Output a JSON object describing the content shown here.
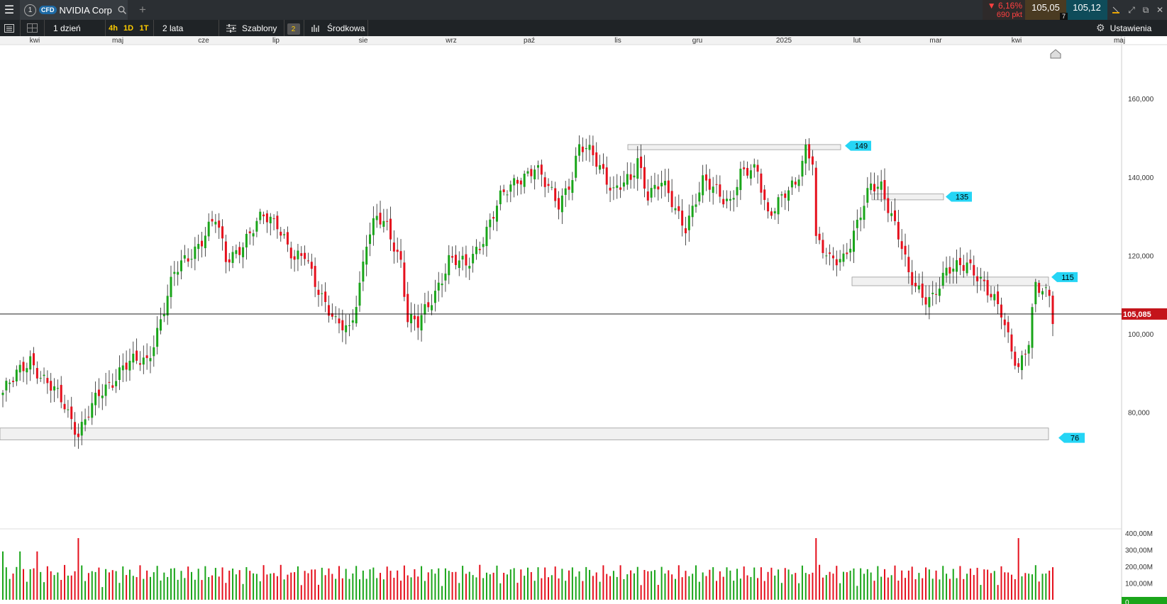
{
  "topbar": {
    "instrument_number": "1",
    "instrument_type": "CFD",
    "instrument_name": "NVIDIA Corp",
    "change_pct": "▼ 6,16%",
    "change_pts": "690 pkt",
    "bid": "105,05",
    "ask": "105,12",
    "spread": "7"
  },
  "toolbar": {
    "interval": "1 dzień",
    "quick_intervals": [
      "4h",
      "1D",
      "1T"
    ],
    "range": "2 lata",
    "templates": "Szablony",
    "templates_count": "2",
    "indicator": "Środkowa",
    "settings": "Ustawienia"
  },
  "colors": {
    "up": "#1aa51a",
    "down": "#e5101d",
    "current_price_bg": "#c4141b",
    "level_bg": "#25d5f5"
  },
  "chart_data": {
    "type": "candlestick",
    "xaxis_months": [
      "kwi",
      "maj",
      "cze",
      "lip",
      "sie",
      "wrz",
      "paź",
      "lis",
      "gru",
      "2025",
      "lut",
      "mar",
      "kwi",
      "maj"
    ],
    "ylim": [
      68000,
      168000
    ],
    "yticks": [
      "160,000",
      "140,000",
      "120,000",
      "100,000",
      "80,000"
    ],
    "current_price": "105,085",
    "current_price_value": 105085,
    "levels": [
      {
        "label": "149",
        "value": 148000,
        "zone": [
          147000,
          148300
        ]
      },
      {
        "label": "135",
        "value": 135000,
        "zone": [
          134200,
          135700
        ]
      },
      {
        "label": "115",
        "value": 114500,
        "zone": [
          112300,
          114500
        ]
      },
      {
        "label": "76",
        "value": 73500,
        "zone": [
          73000,
          76000
        ]
      }
    ],
    "price_anchors": [
      [
        0,
        85000
      ],
      [
        3,
        88000
      ],
      [
        8,
        94000
      ],
      [
        12,
        88000
      ],
      [
        18,
        82000
      ],
      [
        22,
        75000
      ],
      [
        28,
        84000
      ],
      [
        35,
        92000
      ],
      [
        42,
        93000
      ],
      [
        46,
        104000
      ],
      [
        50,
        115000
      ],
      [
        55,
        121000
      ],
      [
        62,
        129000
      ],
      [
        65,
        119000
      ],
      [
        72,
        125000
      ],
      [
        76,
        130000
      ],
      [
        80,
        129000
      ],
      [
        85,
        118000
      ],
      [
        88,
        120000
      ],
      [
        93,
        110000
      ],
      [
        97,
        102000
      ],
      [
        101,
        101000
      ],
      [
        104,
        113000
      ],
      [
        106,
        124000
      ],
      [
        109,
        129000
      ],
      [
        112,
        127000
      ],
      [
        116,
        119000
      ],
      [
        118,
        104000
      ],
      [
        121,
        102000
      ],
      [
        124,
        107000
      ],
      [
        130,
        119000
      ],
      [
        135,
        117000
      ],
      [
        140,
        125000
      ],
      [
        145,
        134000
      ],
      [
        150,
        140000
      ],
      [
        155,
        142000
      ],
      [
        158,
        138000
      ],
      [
        162,
        134000
      ],
      [
        166,
        140000
      ],
      [
        168,
        147000
      ],
      [
        172,
        146000
      ],
      [
        175,
        142000
      ],
      [
        178,
        136000
      ],
      [
        183,
        139000
      ],
      [
        185,
        145000
      ],
      [
        188,
        136000
      ],
      [
        192,
        138000
      ],
      [
        196,
        132000
      ],
      [
        199,
        128000
      ],
      [
        204,
        138000
      ],
      [
        208,
        137000
      ],
      [
        212,
        134000
      ],
      [
        215,
        140000
      ],
      [
        220,
        142000
      ],
      [
        223,
        131000
      ],
      [
        227,
        134000
      ],
      [
        231,
        138000
      ],
      [
        234,
        148000
      ],
      [
        236,
        145000
      ],
      [
        237,
        124000
      ],
      [
        241,
        118000
      ],
      [
        245,
        120000
      ],
      [
        249,
        128000
      ],
      [
        253,
        137000
      ],
      [
        256,
        138000
      ],
      [
        259,
        131000
      ],
      [
        262,
        122000
      ],
      [
        264,
        114000
      ],
      [
        268,
        110000
      ],
      [
        271,
        110000
      ],
      [
        275,
        115000
      ],
      [
        278,
        117000
      ],
      [
        281,
        119000
      ],
      [
        284,
        115000
      ],
      [
        287,
        110000
      ],
      [
        291,
        106000
      ],
      [
        294,
        97000
      ],
      [
        296,
        91000
      ],
      [
        299,
        97000
      ],
      [
        301,
        112000
      ],
      [
        305,
        111000
      ],
      [
        306,
        105000
      ]
    ],
    "volume_yticks": [
      "400,00M",
      "300,00M",
      "200,00M",
      "100,00M"
    ],
    "volume_ylim": [
      0,
      400
    ],
    "volume_current": "0"
  }
}
